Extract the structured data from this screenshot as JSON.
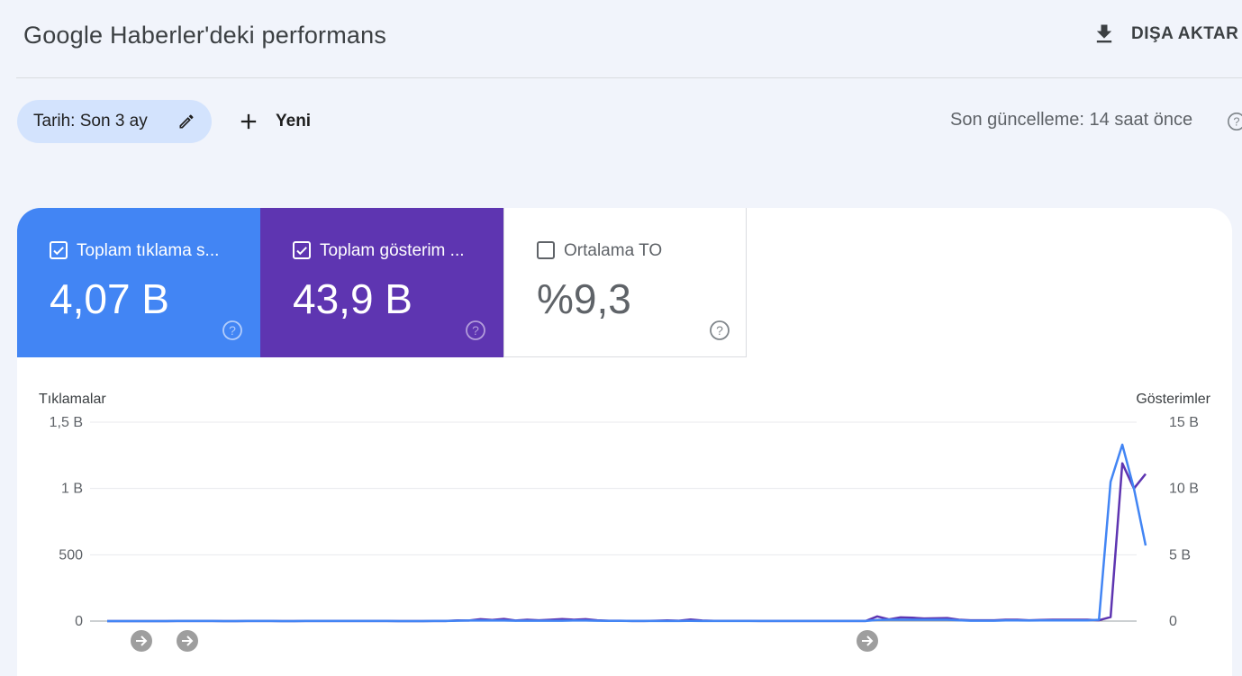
{
  "header": {
    "title": "Google Haberler'deki performans",
    "export_label": "DIŞA AKTAR"
  },
  "filters": {
    "date_chip_label": "Tarih: Son 3 ay",
    "new_label": "Yeni",
    "last_update": "Son güncelleme: 14 saat önce"
  },
  "metrics": [
    {
      "label": "Toplam tıklama s...",
      "value": "4,07 B",
      "checked": true,
      "color": "#4285f4"
    },
    {
      "label": "Toplam gösterim ...",
      "value": "43,9 B",
      "checked": true,
      "color": "#5e35b1"
    },
    {
      "label": "Ortalama TO",
      "value": "%9,3",
      "checked": false,
      "color": "#ffffff"
    }
  ],
  "icons": {
    "export": "download-icon",
    "edit": "pencil-icon",
    "add": "plus-icon",
    "help": "help-circle-icon",
    "annotation": "arrow-right-circle-icon"
  },
  "chart_data": {
    "type": "line",
    "left_axis": {
      "label": "Tıklamalar",
      "ticks": [
        "0",
        "500",
        "1 B",
        "1,5 B"
      ],
      "tick_values": [
        0,
        500,
        1000,
        1500
      ],
      "ylim": [
        0,
        1500
      ]
    },
    "right_axis": {
      "label": "Gösterimler",
      "ticks": [
        "0",
        "5 B",
        "10 B",
        "15 B"
      ],
      "tick_values": [
        0,
        5000,
        10000,
        15000
      ],
      "ylim": [
        0,
        15000
      ]
    },
    "grid": true,
    "series": [
      {
        "axis": "left",
        "color": "#4285f4",
        "values": [
          0,
          0,
          0,
          0,
          0,
          0,
          1,
          1,
          1,
          1,
          0,
          0,
          1,
          1,
          1,
          0,
          0,
          1,
          1,
          1,
          1,
          1,
          1,
          1,
          1,
          0,
          0,
          0,
          1,
          1,
          3,
          4,
          4,
          4,
          4,
          3,
          3,
          3,
          3,
          3,
          4,
          4,
          3,
          2,
          2,
          1,
          1,
          1,
          1,
          1,
          2,
          1,
          1,
          1,
          1,
          1,
          1,
          1,
          1,
          1,
          1,
          1,
          1,
          1,
          1,
          1,
          8,
          10,
          10,
          10,
          10,
          10,
          10,
          6,
          3,
          3,
          3,
          5,
          5,
          4,
          5,
          5,
          5,
          5,
          5,
          10,
          1050,
          1330,
          1000,
          570
        ]
      },
      {
        "axis": "right",
        "color": "#5e35b1",
        "values": [
          0,
          0,
          0,
          0,
          0,
          0,
          10,
          10,
          10,
          10,
          0,
          0,
          10,
          10,
          10,
          0,
          0,
          10,
          10,
          10,
          10,
          10,
          10,
          10,
          10,
          0,
          0,
          0,
          10,
          10,
          50,
          40,
          140,
          80,
          160,
          40,
          100,
          60,
          100,
          150,
          100,
          140,
          60,
          30,
          30,
          10,
          10,
          30,
          50,
          30,
          120,
          40,
          20,
          20,
          20,
          20,
          10,
          10,
          10,
          10,
          10,
          10,
          10,
          10,
          10,
          10,
          350,
          130,
          280,
          250,
          200,
          210,
          230,
          100,
          60,
          60,
          60,
          100,
          100,
          60,
          80,
          100,
          100,
          100,
          100,
          60,
          300,
          11900,
          10000,
          11100
        ]
      }
    ],
    "annotations": 3
  }
}
